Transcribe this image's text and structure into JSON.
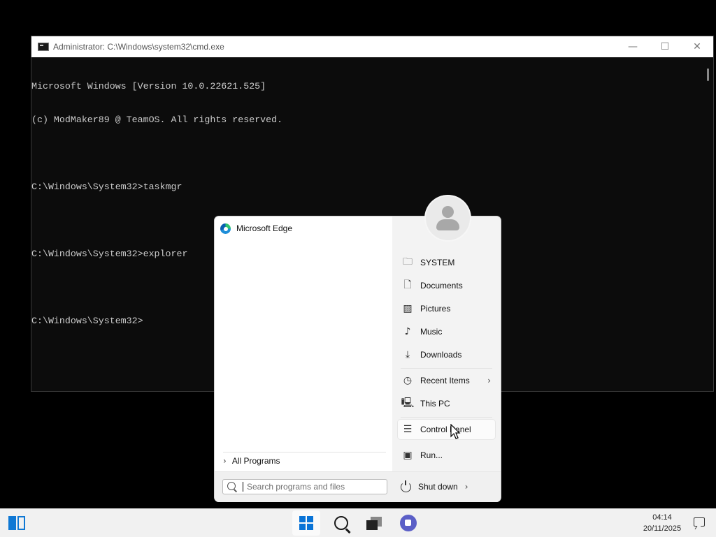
{
  "cmd_window": {
    "title": "Administrator: C:\\Windows\\system32\\cmd.exe",
    "minimize_glyph": "—",
    "maximize_glyph": "☐",
    "close_glyph": "✕",
    "lines": [
      "Microsoft Windows [Version 10.0.22621.525]",
      "(c) ModMaker89 @ TeamOS. All rights reserved.",
      "",
      "C:\\Windows\\System32>taskmgr",
      "",
      "C:\\Windows\\System32>explorer",
      "",
      "C:\\Windows\\System32>"
    ]
  },
  "start_menu": {
    "pinned": [
      {
        "label": "Microsoft Edge",
        "icon": "edge-icon"
      }
    ],
    "all_programs_label": "All Programs",
    "places": [
      {
        "label": "SYSTEM",
        "icon": "user-folder-icon"
      },
      {
        "label": "Documents",
        "icon": "document-icon"
      },
      {
        "label": "Pictures",
        "icon": "picture-icon"
      },
      {
        "label": "Music",
        "icon": "music-icon"
      },
      {
        "label": "Downloads",
        "icon": "download-icon"
      },
      {
        "label": "Recent Items",
        "icon": "clock-icon"
      },
      {
        "label": "This PC",
        "icon": "computer-icon"
      },
      {
        "label": "Control Panel",
        "icon": "control-panel-icon"
      },
      {
        "label": "Run...",
        "icon": "run-icon"
      }
    ],
    "search_placeholder": "Search programs and files",
    "shutdown_label": "Shut down"
  },
  "taskbar": {
    "time": "04:14",
    "date": "20/11/2025"
  },
  "colors": {
    "accent": "#0a74d7",
    "console_bg": "#0c0c0c",
    "console_text": "#cccccc"
  }
}
